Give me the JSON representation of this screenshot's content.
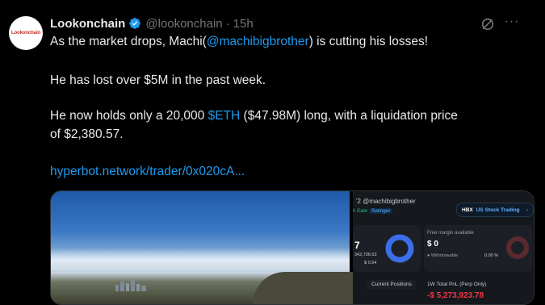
{
  "tweet": {
    "avatar_text": "Lookonchain",
    "author_name": "Lookonchain",
    "handle": "@lookonchain",
    "separator": "·",
    "time": "15h",
    "more": "···",
    "line1_pre": "As the market drops, Machi(",
    "line1_mention": "@machibigbrother",
    "line1_post": ") is cutting his losses!",
    "line2": "He has lost over $5M in the past week.",
    "line3_pre": "He now holds only a 20,000 ",
    "line3_cashtag": "$ETH",
    "line3_post": " ($47.98M) long, with a liquidation price",
    "line4": "of $2,380.57.",
    "link": "hyperbot.network/trader/0x020cA..."
  },
  "panel": {
    "title": "'2 @machibigbrother",
    "tag1": "ll Gain",
    "tag2": "Swinger",
    "badge_brand": "HBX",
    "badge_text": "US Stock Trading",
    "badge_arrow": "›",
    "left_big": "7",
    "left_v1": "342,736.53",
    "left_v2": "$ 0.54",
    "fm_label": "Free margin available",
    "fm_value": "$ 0",
    "withdrawable": "● Withdrawable",
    "pct": "0.00 %",
    "current_positions": "Current Positions",
    "pnl_label": "1W Total PnL (Perp Only)",
    "pnl_value": "-$ 5,273,923.78"
  },
  "colors": {
    "link": "#1d9bf0",
    "verified": "#1d9bf0",
    "muted": "#71767b",
    "loss": "#f23645"
  }
}
